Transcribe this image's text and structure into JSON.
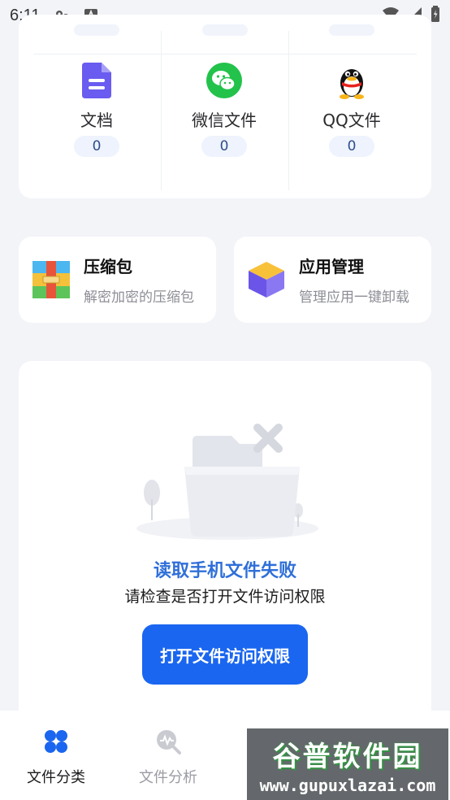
{
  "status_bar": {
    "time": "6:11"
  },
  "categories": [
    {
      "label": "文档",
      "count": "0",
      "icon": "document-icon"
    },
    {
      "label": "微信文件",
      "count": "0",
      "icon": "wechat-icon"
    },
    {
      "label": "QQ文件",
      "count": "0",
      "icon": "qq-icon"
    }
  ],
  "tools": [
    {
      "title": "压缩包",
      "subtitle": "解密加密的压缩包",
      "icon": "archive-icon"
    },
    {
      "title": "应用管理",
      "subtitle": "管理应用一键卸载",
      "icon": "app-box-icon"
    }
  ],
  "empty_state": {
    "title": "读取手机文件失败",
    "subtitle": "请检查是否打开文件访问权限",
    "button": "打开文件访问权限"
  },
  "bottom_nav": [
    {
      "label": "文件分类",
      "active": true
    },
    {
      "label": "文件分析",
      "active": false
    }
  ],
  "watermark": {
    "title": "谷普软件园",
    "url": "www.gupuxlazai.com"
  },
  "colors": {
    "accent": "#1a66f0",
    "title_blue": "#2f6fd9",
    "background": "#f3f4f8"
  }
}
